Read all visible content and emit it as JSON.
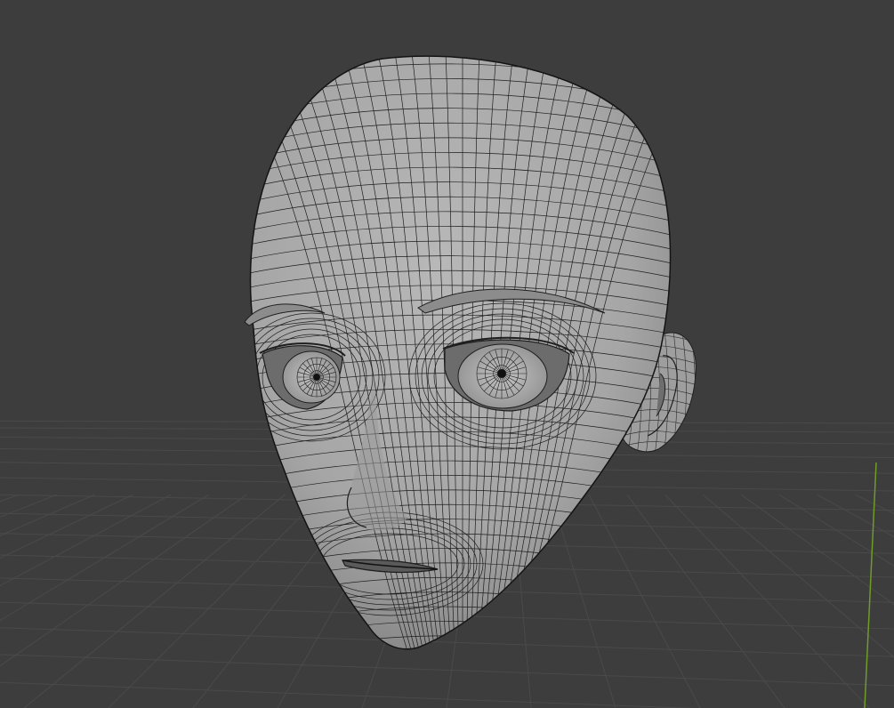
{
  "viewport": {
    "background": "#3d3d3d",
    "grid_color": "#4a4a4a",
    "y_axis_color": "#6f9b2a",
    "mesh_fill": "#a9a9a9",
    "mesh_shadow": "#7c7c7c",
    "wire_color": "#1e1e1e",
    "object": "head-mesh"
  }
}
